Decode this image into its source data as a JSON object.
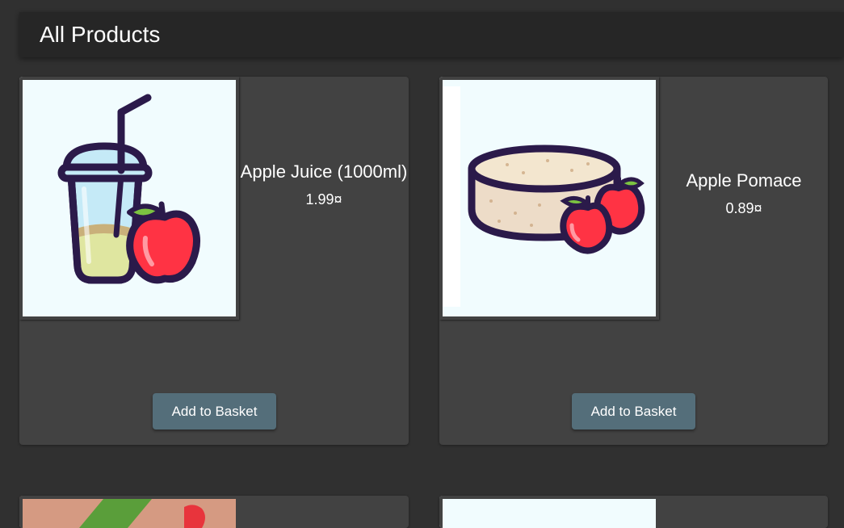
{
  "page": {
    "title": "All Products"
  },
  "products": [
    {
      "name": "Apple Juice (1000ml)",
      "price": "1.99¤",
      "button_label": "Add to Basket",
      "image_icon": "apple-juice-cup-icon"
    },
    {
      "name": "Apple Pomace",
      "price": "0.89¤",
      "button_label": "Add to Basket",
      "image_icon": "apple-pomace-icon"
    }
  ],
  "colors": {
    "background": "#303030",
    "card": "#424242",
    "header": "#262626",
    "button": "#546e7a",
    "image_bg": "#f1fcfe",
    "apple_red": "#ff3344",
    "outline": "#2b1a4a",
    "ribbon_green": "#5a9e3a"
  }
}
